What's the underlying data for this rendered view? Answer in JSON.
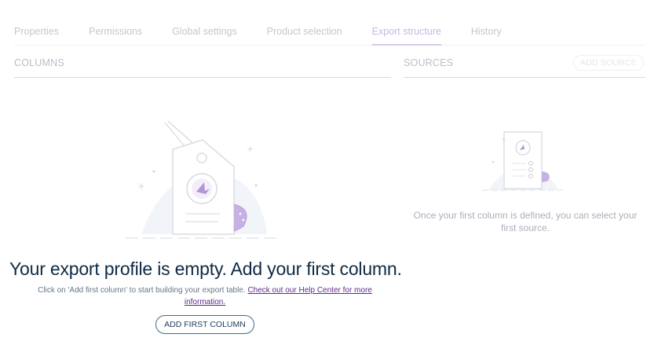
{
  "tabs": [
    {
      "label": "Properties"
    },
    {
      "label": "Permissions"
    },
    {
      "label": "Global settings"
    },
    {
      "label": "Product selection"
    },
    {
      "label": "Export structure"
    },
    {
      "label": "History"
    }
  ],
  "active_tab": "Export structure",
  "columns_header": "COLUMNS",
  "sources_header": "SOURCES",
  "add_source_label": "ADD SOURCE",
  "sources_empty_text": "Once your first column is defined, you can select your first source.",
  "empty_state": {
    "title": "Your export profile is empty. Add your first column.",
    "description": "Click on 'Add first column' to start building your export table.",
    "help_link": "Check out our Help Center for more information.",
    "button_label": "ADD FIRST COLUMN"
  },
  "colors": {
    "accent_purple": "#9b72c8",
    "primary_text": "#11324d",
    "link": "#5e2a8c"
  }
}
